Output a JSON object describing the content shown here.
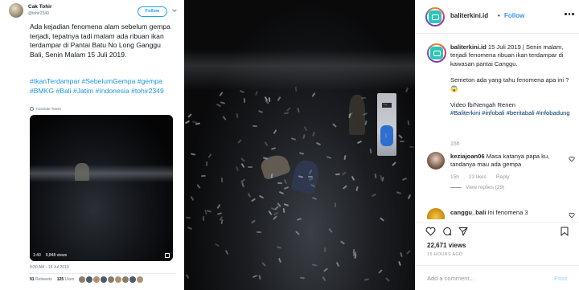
{
  "tweet": {
    "name": "Cak Tohir",
    "handle": "@tohir2349",
    "follow_label": "Follow",
    "text": "Ada kejadian fenomena alam sebelum gempa terjadi, tepatnya tadi malam ada ribuan ikan terdampar di Pantai Batu No Long Ganggu Bali, Senin Malam 15 Juli 2019.",
    "hashtags": "#IkanTerdampar #SebelumGempa #gempa #BMKG #Bali #Jatim #Indonesia #tohir2349",
    "translate": "Translate Tweet",
    "video_duration": "1:40",
    "video_views": "9,848 views",
    "timestamp": "8:30 AM - 16 Jul 2019",
    "retweets_count": "91",
    "retweets_label": "Retweets",
    "likes_count": "125",
    "likes_label": "Likes"
  },
  "instagram": {
    "username": "baliterkini.id",
    "separator": "•",
    "follow_label": "Follow",
    "caption_user": "baliterkini.id",
    "caption_text": " 15 Juli 2019 | Senin malam, terjadi fenomena ribuan ikan terdampar di kawasan pantai Canggu.",
    "caption_q": "Semeton ada yang tahu fenomena apa ini ? 😱",
    "caption_credit": "Video fb/Nengah Renen",
    "caption_tags": "#Baliterkini #infobali #beritabali #infobadung",
    "caption_time": "15h",
    "comments": [
      {
        "user": "keziajoan06",
        "text": " Masa katanya papa ku, tandanya mau ada gempa",
        "time": "15h",
        "likes": "23 likes",
        "reply": "Reply",
        "view_replies": "View replies (29)"
      },
      {
        "user": "canggu_bali",
        "text": " Ini fenomena 3"
      }
    ],
    "likes": "22,671 views",
    "posted_ago": "15 HOURS AGO",
    "add_comment_placeholder": "Add a comment...",
    "post_label": "Post",
    "accent": "#3897f0",
    "logo_color": "#30c4b5"
  }
}
